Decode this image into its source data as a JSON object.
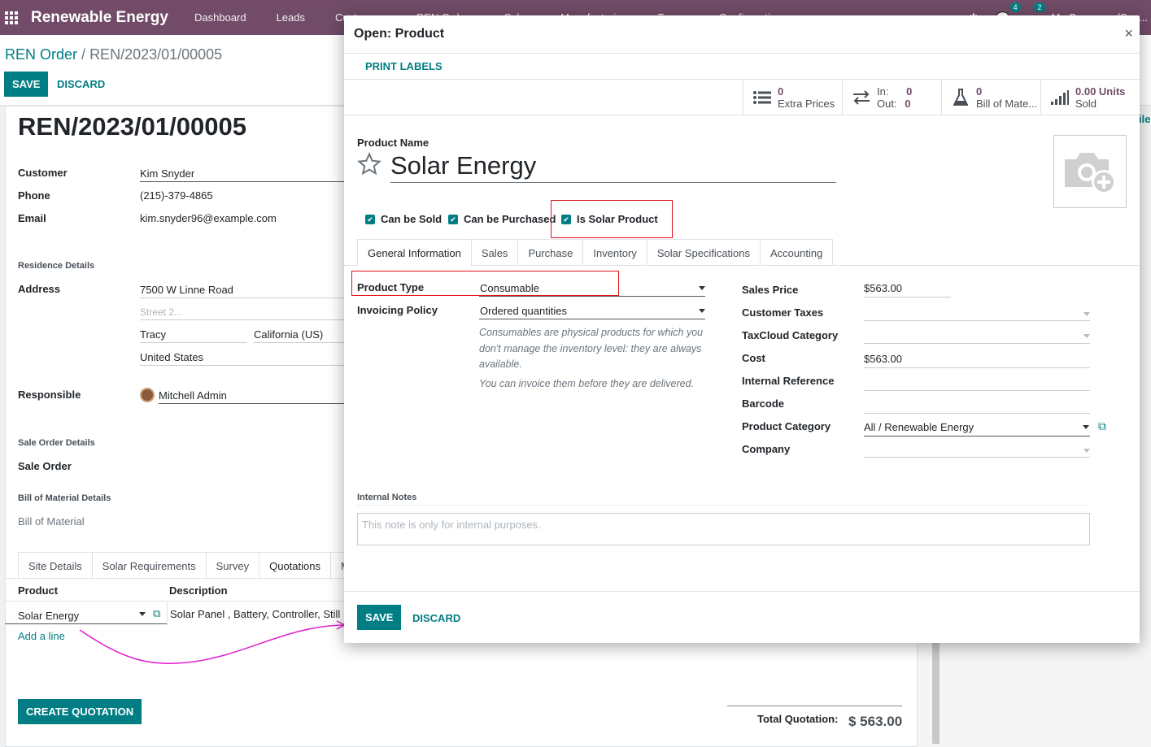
{
  "navbar": {
    "brand": "Renewable Energy",
    "menu": [
      "Dashboard",
      "Leads",
      "Customers",
      "REN Orders",
      "Sales",
      "Manufacturing",
      "Teams",
      "Configurations"
    ],
    "messages_count": "4",
    "activities_count": "2",
    "company": "My Company (San..."
  },
  "breadcrumb": {
    "parent": "REN Order",
    "separator": "/",
    "current": "REN/2023/01/00005"
  },
  "bg_buttons": {
    "save": "SAVE",
    "discard": "DISCARD"
  },
  "order": {
    "number": "REN/2023/01/00005",
    "fields": {
      "customer_label": "Customer",
      "customer": "Kim Snyder",
      "phone_label": "Phone",
      "phone": "(215)-379-4865",
      "email_label": "Email",
      "email": "kim.snyder96@example.com",
      "residence_section": "Residence Details",
      "address_label": "Address",
      "street": "7500 W Linne Road",
      "street2_placeholder": "Street 2...",
      "city": "Tracy",
      "state": "California (US)",
      "country": "United States",
      "responsible_label": "Responsible",
      "responsible": "Mitchell Admin",
      "sale_order_section": "Sale Order Details",
      "sale_order_label": "Sale Order",
      "bom_section": "Bill of Material Details",
      "bom_label": "Bill of Material"
    },
    "tabs": [
      "Site Details",
      "Solar Requirements",
      "Survey",
      "Quotations",
      "M"
    ],
    "table_headers": {
      "product": "Product",
      "description": "Description"
    },
    "row": {
      "product": "Solar Energy",
      "description": "Solar Panel , Battery,  Controller,  Still"
    },
    "add_line": "Add a line",
    "create_quotation": "CREATE QUOTATION",
    "total_label": "Total Quotation:",
    "total_value": "$ 563.00",
    "right_fragment": "ile"
  },
  "modal": {
    "title": "Open: Product",
    "close": "×",
    "print_labels": "PRINT LABELS",
    "stats": [
      {
        "icon": "list-icon",
        "value": "0",
        "label": "Extra Prices"
      },
      {
        "icon": "transfer-arrows-icon",
        "in_label": "In:",
        "in_value": "0",
        "out_label": "Out:",
        "out_value": "0"
      },
      {
        "icon": "flask-icon",
        "value": "0",
        "label": "Bill of Mate..."
      },
      {
        "icon": "signal-bars-icon",
        "value": "0.00 Units",
        "label": "Sold"
      }
    ],
    "product_name_label": "Product Name",
    "product_name": "Solar Energy",
    "checkboxes": {
      "can_be_sold": "Can be Sold",
      "can_be_purchased": "Can be Purchased",
      "is_solar_product": "Is Solar Product"
    },
    "tabs": [
      "General Information",
      "Sales",
      "Purchase",
      "Inventory",
      "Solar Specifications",
      "Accounting"
    ],
    "left": {
      "product_type_label": "Product Type",
      "product_type": "Consumable",
      "invoicing_policy_label": "Invoicing Policy",
      "invoicing_policy": "Ordered quantities",
      "help1": "Consumables are physical products for which you don't manage the inventory level: they are always available.",
      "help2": "You can invoice them before they are delivered."
    },
    "right": {
      "sales_price_label": "Sales Price",
      "sales_price": "$563.00",
      "customer_taxes_label": "Customer Taxes",
      "taxcloud_label": "TaxCloud Category",
      "cost_label": "Cost",
      "cost": "$563.00",
      "internal_ref_label": "Internal Reference",
      "barcode_label": "Barcode",
      "product_category_label": "Product Category",
      "product_category": "All / Renewable Energy",
      "company_label": "Company"
    },
    "internal_notes_label": "Internal Notes",
    "internal_notes_placeholder": "This note is only for internal purposes.",
    "footer": {
      "save": "SAVE",
      "discard": "DISCARD"
    }
  },
  "colors": {
    "brand": "#714B67",
    "accent": "#017e84",
    "highlight": "#e0121b",
    "annotation_arrow": "#e020d0"
  }
}
